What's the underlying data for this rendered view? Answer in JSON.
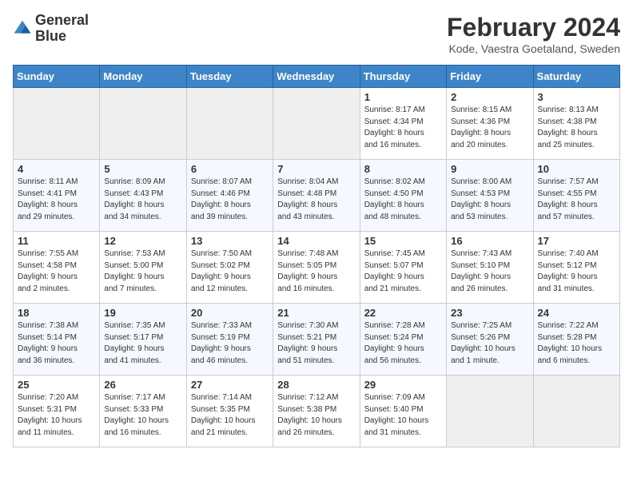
{
  "header": {
    "logo_line1": "General",
    "logo_line2": "Blue",
    "month": "February 2024",
    "location": "Kode, Vaestra Goetaland, Sweden"
  },
  "weekdays": [
    "Sunday",
    "Monday",
    "Tuesday",
    "Wednesday",
    "Thursday",
    "Friday",
    "Saturday"
  ],
  "weeks": [
    [
      {
        "day": "",
        "info": ""
      },
      {
        "day": "",
        "info": ""
      },
      {
        "day": "",
        "info": ""
      },
      {
        "day": "",
        "info": ""
      },
      {
        "day": "1",
        "info": "Sunrise: 8:17 AM\nSunset: 4:34 PM\nDaylight: 8 hours\nand 16 minutes."
      },
      {
        "day": "2",
        "info": "Sunrise: 8:15 AM\nSunset: 4:36 PM\nDaylight: 8 hours\nand 20 minutes."
      },
      {
        "day": "3",
        "info": "Sunrise: 8:13 AM\nSunset: 4:38 PM\nDaylight: 8 hours\nand 25 minutes."
      }
    ],
    [
      {
        "day": "4",
        "info": "Sunrise: 8:11 AM\nSunset: 4:41 PM\nDaylight: 8 hours\nand 29 minutes."
      },
      {
        "day": "5",
        "info": "Sunrise: 8:09 AM\nSunset: 4:43 PM\nDaylight: 8 hours\nand 34 minutes."
      },
      {
        "day": "6",
        "info": "Sunrise: 8:07 AM\nSunset: 4:46 PM\nDaylight: 8 hours\nand 39 minutes."
      },
      {
        "day": "7",
        "info": "Sunrise: 8:04 AM\nSunset: 4:48 PM\nDaylight: 8 hours\nand 43 minutes."
      },
      {
        "day": "8",
        "info": "Sunrise: 8:02 AM\nSunset: 4:50 PM\nDaylight: 8 hours\nand 48 minutes."
      },
      {
        "day": "9",
        "info": "Sunrise: 8:00 AM\nSunset: 4:53 PM\nDaylight: 8 hours\nand 53 minutes."
      },
      {
        "day": "10",
        "info": "Sunrise: 7:57 AM\nSunset: 4:55 PM\nDaylight: 8 hours\nand 57 minutes."
      }
    ],
    [
      {
        "day": "11",
        "info": "Sunrise: 7:55 AM\nSunset: 4:58 PM\nDaylight: 9 hours\nand 2 minutes."
      },
      {
        "day": "12",
        "info": "Sunrise: 7:53 AM\nSunset: 5:00 PM\nDaylight: 9 hours\nand 7 minutes."
      },
      {
        "day": "13",
        "info": "Sunrise: 7:50 AM\nSunset: 5:02 PM\nDaylight: 9 hours\nand 12 minutes."
      },
      {
        "day": "14",
        "info": "Sunrise: 7:48 AM\nSunset: 5:05 PM\nDaylight: 9 hours\nand 16 minutes."
      },
      {
        "day": "15",
        "info": "Sunrise: 7:45 AM\nSunset: 5:07 PM\nDaylight: 9 hours\nand 21 minutes."
      },
      {
        "day": "16",
        "info": "Sunrise: 7:43 AM\nSunset: 5:10 PM\nDaylight: 9 hours\nand 26 minutes."
      },
      {
        "day": "17",
        "info": "Sunrise: 7:40 AM\nSunset: 5:12 PM\nDaylight: 9 hours\nand 31 minutes."
      }
    ],
    [
      {
        "day": "18",
        "info": "Sunrise: 7:38 AM\nSunset: 5:14 PM\nDaylight: 9 hours\nand 36 minutes."
      },
      {
        "day": "19",
        "info": "Sunrise: 7:35 AM\nSunset: 5:17 PM\nDaylight: 9 hours\nand 41 minutes."
      },
      {
        "day": "20",
        "info": "Sunrise: 7:33 AM\nSunset: 5:19 PM\nDaylight: 9 hours\nand 46 minutes."
      },
      {
        "day": "21",
        "info": "Sunrise: 7:30 AM\nSunset: 5:21 PM\nDaylight: 9 hours\nand 51 minutes."
      },
      {
        "day": "22",
        "info": "Sunrise: 7:28 AM\nSunset: 5:24 PM\nDaylight: 9 hours\nand 56 minutes."
      },
      {
        "day": "23",
        "info": "Sunrise: 7:25 AM\nSunset: 5:26 PM\nDaylight: 10 hours\nand 1 minute."
      },
      {
        "day": "24",
        "info": "Sunrise: 7:22 AM\nSunset: 5:28 PM\nDaylight: 10 hours\nand 6 minutes."
      }
    ],
    [
      {
        "day": "25",
        "info": "Sunrise: 7:20 AM\nSunset: 5:31 PM\nDaylight: 10 hours\nand 11 minutes."
      },
      {
        "day": "26",
        "info": "Sunrise: 7:17 AM\nSunset: 5:33 PM\nDaylight: 10 hours\nand 16 minutes."
      },
      {
        "day": "27",
        "info": "Sunrise: 7:14 AM\nSunset: 5:35 PM\nDaylight: 10 hours\nand 21 minutes."
      },
      {
        "day": "28",
        "info": "Sunrise: 7:12 AM\nSunset: 5:38 PM\nDaylight: 10 hours\nand 26 minutes."
      },
      {
        "day": "29",
        "info": "Sunrise: 7:09 AM\nSunset: 5:40 PM\nDaylight: 10 hours\nand 31 minutes."
      },
      {
        "day": "",
        "info": ""
      },
      {
        "day": "",
        "info": ""
      }
    ]
  ]
}
